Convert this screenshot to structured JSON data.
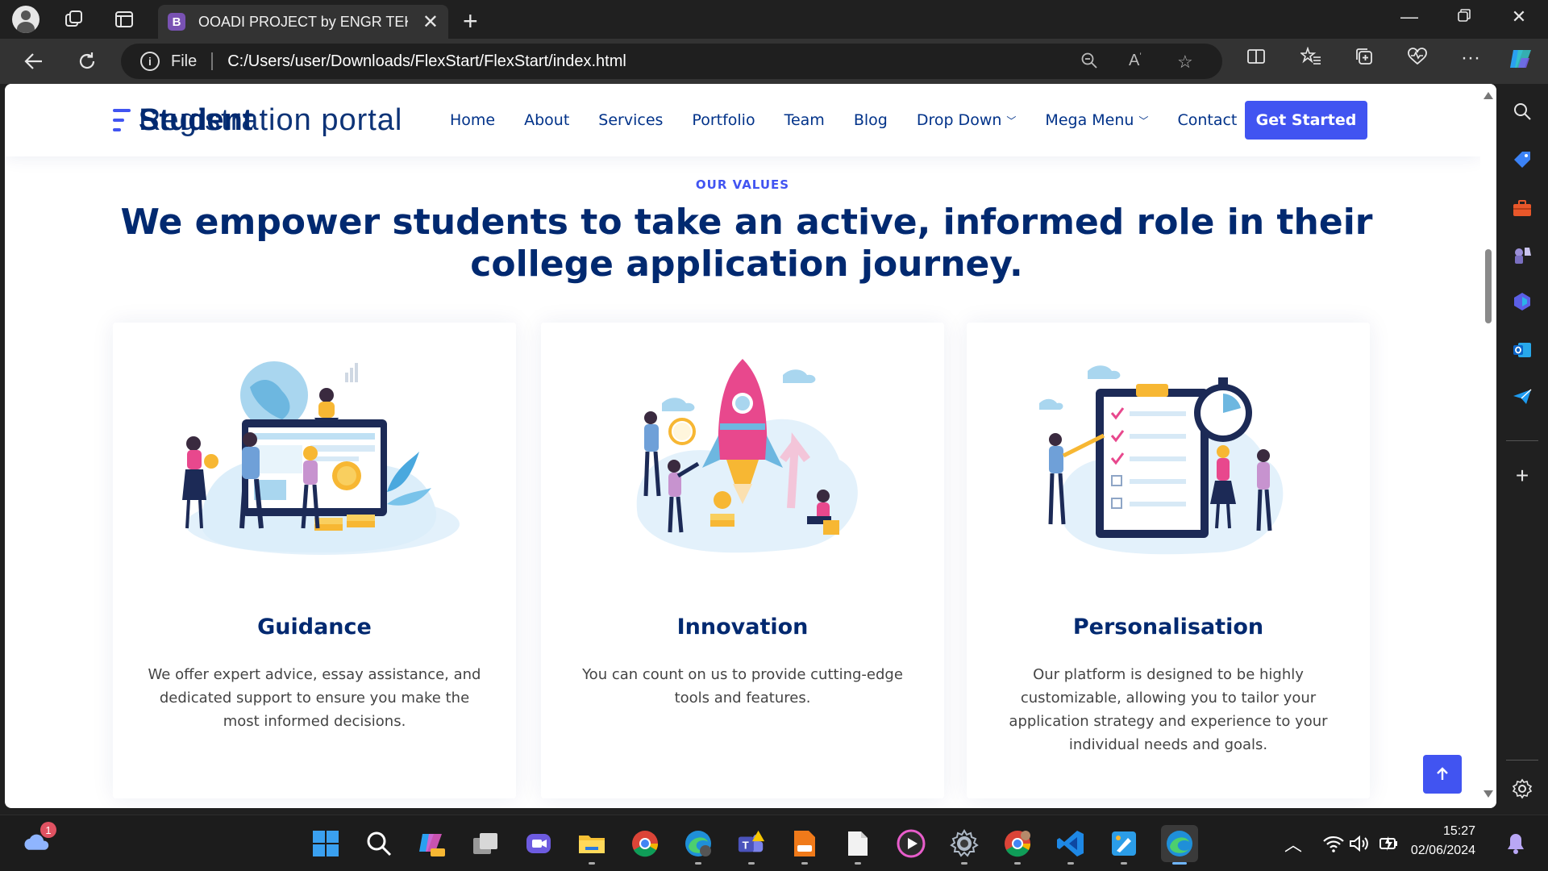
{
  "browser": {
    "tab_title": "OOADI PROJECT by ENGR TEKO",
    "tab_favicon": "B",
    "new_tab_symbol": "+",
    "address_scheme_label": "File",
    "address_url": "C:/Users/user/Downloads/FlexStart/FlexStart/index.html",
    "info_symbol": "i"
  },
  "site": {
    "logo_text_overlay": "Student",
    "logo_text": "Registration portal",
    "nav": [
      {
        "label": "Home"
      },
      {
        "label": "About"
      },
      {
        "label": "Services"
      },
      {
        "label": "Portfolio"
      },
      {
        "label": "Team"
      },
      {
        "label": "Blog"
      },
      {
        "label": "Drop Down",
        "dropdown": true
      },
      {
        "label": "Mega Menu",
        "dropdown": true
      },
      {
        "label": "Contact"
      }
    ],
    "cta_label": "Get Started",
    "accent_color": "#4154f1",
    "heading_color": "#012970"
  },
  "values": {
    "section_label": "OUR VALUES",
    "section_title": "We empower students to take an active, informed role in their college application journey.",
    "cards": [
      {
        "title": "Guidance",
        "text": "We offer expert advice, essay assistance, and dedicated support to ensure you make the most informed decisions.",
        "illustration": "team-dashboard-illustration"
      },
      {
        "title": "Innovation",
        "text": "You can count on us to provide cutting-edge tools and features.",
        "illustration": "rocket-launch-illustration"
      },
      {
        "title": "Personalisation",
        "text": "Our platform is designed to be highly customizable, allowing you to tailor your application strategy and experience to your individual needs and goals.",
        "illustration": "checklist-stopwatch-illustration"
      }
    ]
  },
  "taskbar": {
    "time": "15:27",
    "date": "02/06/2024",
    "weather_badge": "1"
  }
}
